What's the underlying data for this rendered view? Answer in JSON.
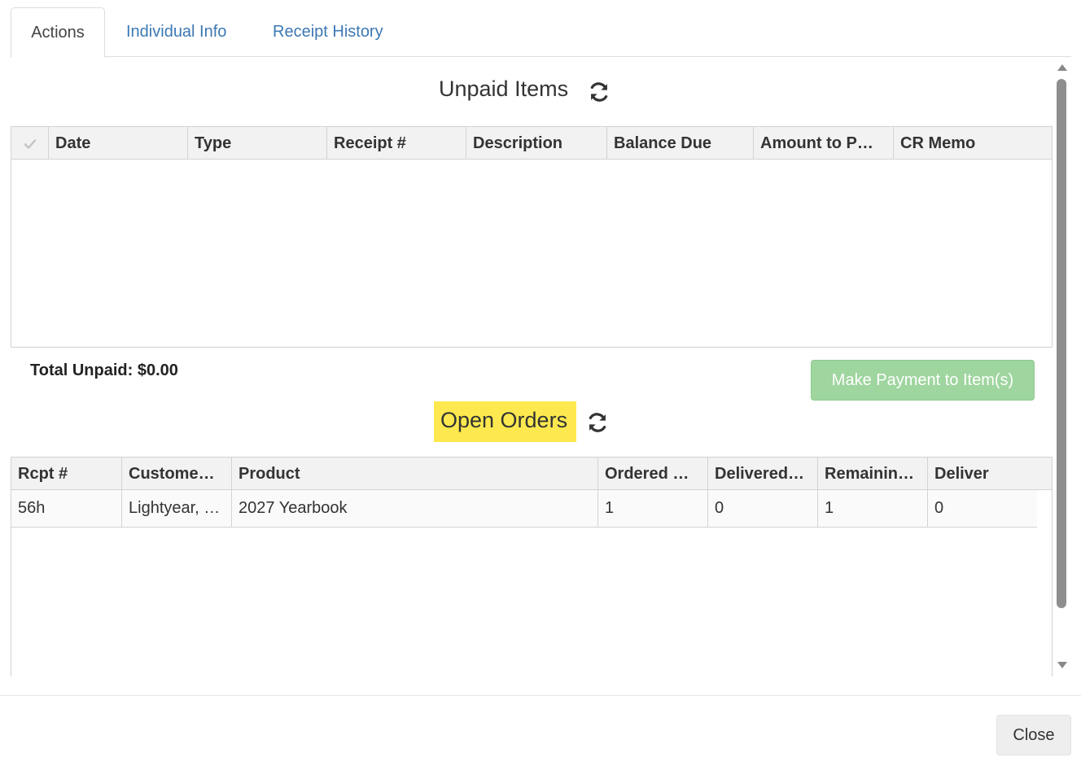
{
  "tabs": [
    {
      "label": "Actions",
      "active": true
    },
    {
      "label": "Individual Info",
      "active": false
    },
    {
      "label": "Receipt History",
      "active": false
    }
  ],
  "unpaid": {
    "title": "Unpaid Items",
    "refresh_icon": "refresh-icon",
    "columns": [
      "Date",
      "Type",
      "Receipt #",
      "Description",
      "Balance Due",
      "Amount to P…",
      "CR Memo"
    ],
    "select_icon": "checkmark-icon",
    "rows": [],
    "total_label": "Total Unpaid: $0.00",
    "pay_button": "Make Payment to Item(s)"
  },
  "orders": {
    "title": "Open Orders",
    "refresh_icon": "refresh-icon",
    "columns": [
      "Rcpt #",
      "Custome…",
      "Product",
      "Ordered …",
      "Delivered…",
      "Remainin…",
      "Deliver"
    ],
    "rows": [
      [
        "56h",
        "Lightyear, …",
        "2027 Yearbook",
        "1",
        "0",
        "1",
        "0"
      ]
    ]
  },
  "footer": {
    "close_label": "Close"
  },
  "colors": {
    "link": "#3d78b4",
    "highlight": "#fde94f",
    "pay_button_bg": "#9fd59f"
  }
}
